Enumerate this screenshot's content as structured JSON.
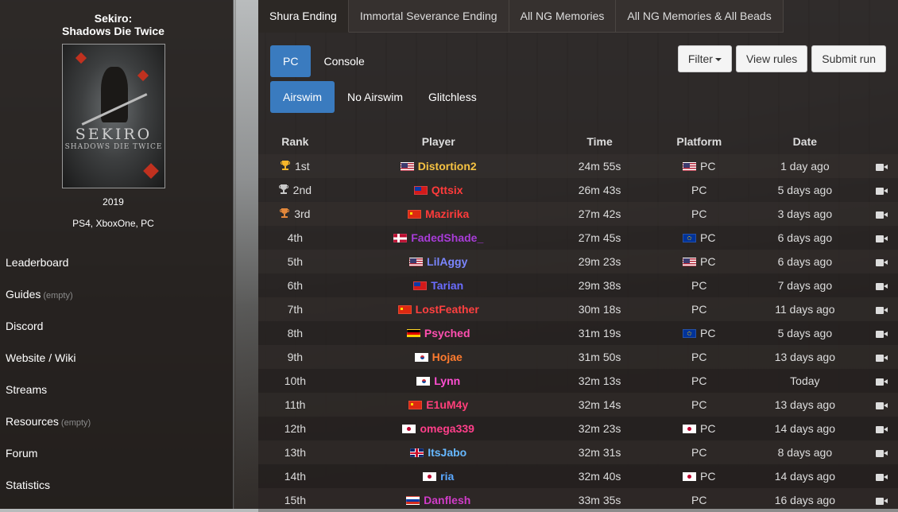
{
  "game": {
    "title_line1": "Sekiro:",
    "title_line2": "Shadows Die Twice",
    "year": "2019",
    "platforms": "PS4, XboxOne, PC",
    "cover_logo": "SEKIRO",
    "cover_sub": "SHADOWS DIE TWICE"
  },
  "nav": [
    {
      "label": "Leaderboard",
      "note": ""
    },
    {
      "label": "Guides",
      "note": "(empty)"
    },
    {
      "label": "Discord",
      "note": ""
    },
    {
      "label": "Website / Wiki",
      "note": ""
    },
    {
      "label": "Streams",
      "note": ""
    },
    {
      "label": "Resources",
      "note": "(empty)"
    },
    {
      "label": "Forum",
      "note": ""
    },
    {
      "label": "Statistics",
      "note": ""
    }
  ],
  "tabs": [
    {
      "label": "Shura Ending",
      "active": true
    },
    {
      "label": "Immortal Severance Ending",
      "active": false
    },
    {
      "label": "All NG Memories",
      "active": false
    },
    {
      "label": "All NG Memories & All Beads",
      "active": false
    }
  ],
  "platform_filter": [
    {
      "label": "PC",
      "selected": true
    },
    {
      "label": "Console",
      "selected": false
    }
  ],
  "subcategory_filter": [
    {
      "label": "Airswim",
      "selected": true
    },
    {
      "label": "No Airswim",
      "selected": false
    },
    {
      "label": "Glitchless",
      "selected": false
    }
  ],
  "actions": {
    "filter": "Filter",
    "view_rules": "View rules",
    "submit_run": "Submit run"
  },
  "columns": {
    "rank": "Rank",
    "player": "Player",
    "time": "Time",
    "platform": "Platform",
    "date": "Date"
  },
  "trophy_colors": {
    "gold": "#f5b52a",
    "silver": "#c9c9c9",
    "bronze": "#e2873b"
  },
  "rows": [
    {
      "rank": "1st",
      "trophy": "gold",
      "flag": "us",
      "player": "Distortion2",
      "color": "#f5c242",
      "time": "24m 55s",
      "plat_flag": "us",
      "platform": "PC",
      "date": "1 day ago"
    },
    {
      "rank": "2nd",
      "trophy": "silver",
      "flag": "tw",
      "player": "Qttsix",
      "color": "#ff3b3b",
      "time": "26m 43s",
      "plat_flag": "",
      "platform": "PC",
      "date": "5 days ago"
    },
    {
      "rank": "3rd",
      "trophy": "bronze",
      "flag": "cn",
      "player": "Mazirika",
      "color": "#ff3b3b",
      "time": "27m 42s",
      "plat_flag": "",
      "platform": "PC",
      "date": "3 days ago"
    },
    {
      "rank": "4th",
      "trophy": "",
      "flag": "no",
      "player": "FadedShade_",
      "color": "#a83cd8",
      "time": "27m 45s",
      "plat_flag": "eu",
      "platform": "PC",
      "date": "6 days ago"
    },
    {
      "rank": "5th",
      "trophy": "",
      "flag": "us",
      "player": "LilAggy",
      "color": "#7b86ff",
      "time": "29m 23s",
      "plat_flag": "us",
      "platform": "PC",
      "date": "6 days ago"
    },
    {
      "rank": "6th",
      "trophy": "",
      "flag": "tw",
      "player": "Tarian",
      "color": "#6a6cff",
      "time": "29m 38s",
      "plat_flag": "",
      "platform": "PC",
      "date": "7 days ago"
    },
    {
      "rank": "7th",
      "trophy": "",
      "flag": "cn",
      "player": "LostFeather",
      "color": "#ff4040",
      "time": "30m 18s",
      "plat_flag": "",
      "platform": "PC",
      "date": "11 days ago"
    },
    {
      "rank": "8th",
      "trophy": "",
      "flag": "de",
      "player": "Psyched",
      "color": "#ff4fb0",
      "time": "31m 19s",
      "plat_flag": "eu",
      "platform": "PC",
      "date": "5 days ago"
    },
    {
      "rank": "9th",
      "trophy": "",
      "flag": "kr",
      "player": "Hojae",
      "color": "#ff7b2e",
      "time": "31m 50s",
      "plat_flag": "",
      "platform": "PC",
      "date": "13 days ago"
    },
    {
      "rank": "10th",
      "trophy": "",
      "flag": "kr",
      "player": "Lynn",
      "color": "#ff4fd2",
      "time": "32m 13s",
      "plat_flag": "",
      "platform": "PC",
      "date": "Today"
    },
    {
      "rank": "11th",
      "trophy": "",
      "flag": "cn",
      "player": "E1uM4y",
      "color": "#ff3f7a",
      "time": "32m 14s",
      "plat_flag": "",
      "platform": "PC",
      "date": "13 days ago"
    },
    {
      "rank": "12th",
      "trophy": "",
      "flag": "jp",
      "player": "omega339",
      "color": "#ff3f8a",
      "time": "32m 23s",
      "plat_flag": "jp",
      "platform": "PC",
      "date": "14 days ago"
    },
    {
      "rank": "13th",
      "trophy": "",
      "flag": "gb",
      "player": "ItsJabo",
      "color": "#66b8ff",
      "time": "32m 31s",
      "plat_flag": "",
      "platform": "PC",
      "date": "8 days ago"
    },
    {
      "rank": "14th",
      "trophy": "",
      "flag": "jp",
      "player": "ria",
      "color": "#5aa8ff",
      "time": "32m 40s",
      "plat_flag": "jp",
      "platform": "PC",
      "date": "14 days ago"
    },
    {
      "rank": "15th",
      "trophy": "",
      "flag": "ru",
      "player": "Danflesh",
      "color": "#d03cc8",
      "time": "33m 35s",
      "plat_flag": "",
      "platform": "PC",
      "date": "16 days ago"
    }
  ]
}
